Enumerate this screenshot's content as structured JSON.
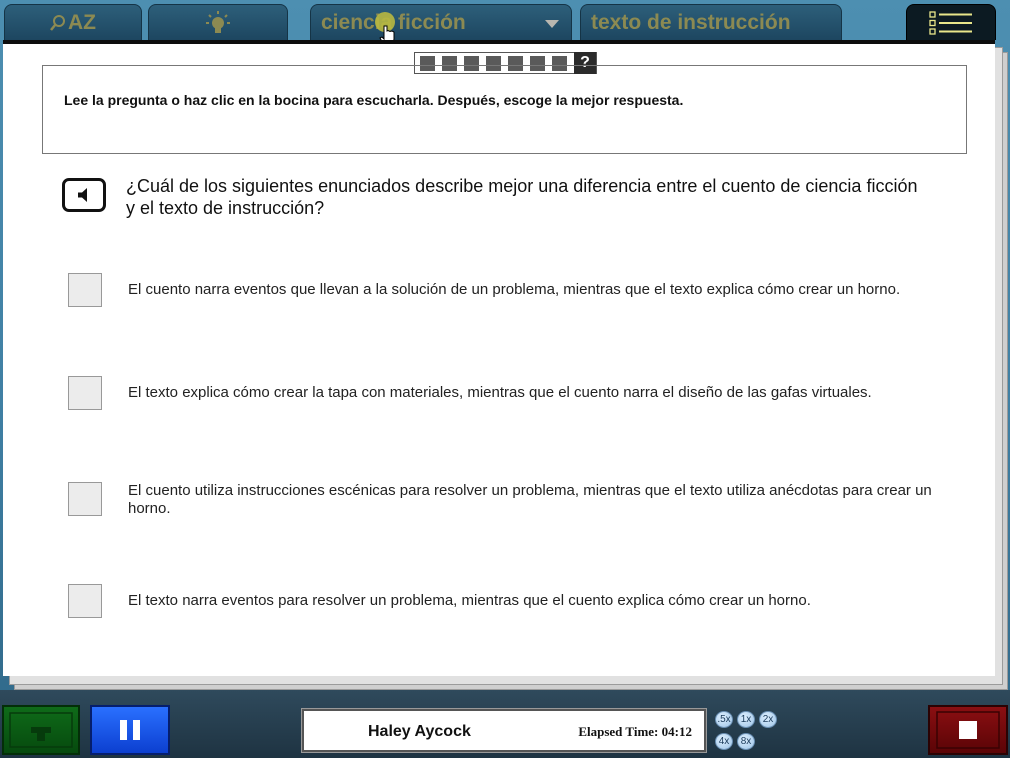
{
  "tabs": {
    "glossary_label": "AZ",
    "passage_1": "ciencia ficción",
    "passage_2": "texto de instrucción"
  },
  "progress": {
    "total": 7,
    "help_label": "?"
  },
  "instructions": "Lee la pregunta o haz clic en la bocina para escucharla. Después, escoge la mejor respuesta.",
  "question": "¿Cuál de los siguientes enunciados describe mejor una diferencia entre el cuento de ciencia ficción y el texto de instrucción?",
  "options": [
    "El cuento narra eventos que llevan a la solución de un problema, mientras que el texto explica cómo crear un horno.",
    "El texto explica cómo crear la tapa con materiales, mientras que el cuento narra el diseño de las gafas virtuales.",
    "El cuento utiliza instrucciones escénicas para resolver un problema, mientras que el texto utiliza anécdotas para crear un horno.",
    "El texto narra eventos para resolver un problema, mientras que el cuento explica cómo crear un horno."
  ],
  "status": {
    "student_name": "Haley Aycock",
    "elapsed_label": "Elapsed Time:",
    "elapsed_time": "04:12"
  },
  "speeds": [
    ".5x",
    "1x",
    "2x",
    "4x",
    "8x"
  ],
  "icons": {
    "glossary": "magnifier-icon",
    "hint": "lightbulb-icon",
    "menu": "list-menu-icon",
    "speaker": "speaker-icon",
    "pause": "pause-icon",
    "stop": "stop-icon"
  },
  "colors": {
    "tab_text": "#8c8a52",
    "menu_accent": "#e8e58a",
    "pause_button": "#1f5cf0",
    "stop_button": "#7a0b0e",
    "green_button": "#0b5c15"
  }
}
